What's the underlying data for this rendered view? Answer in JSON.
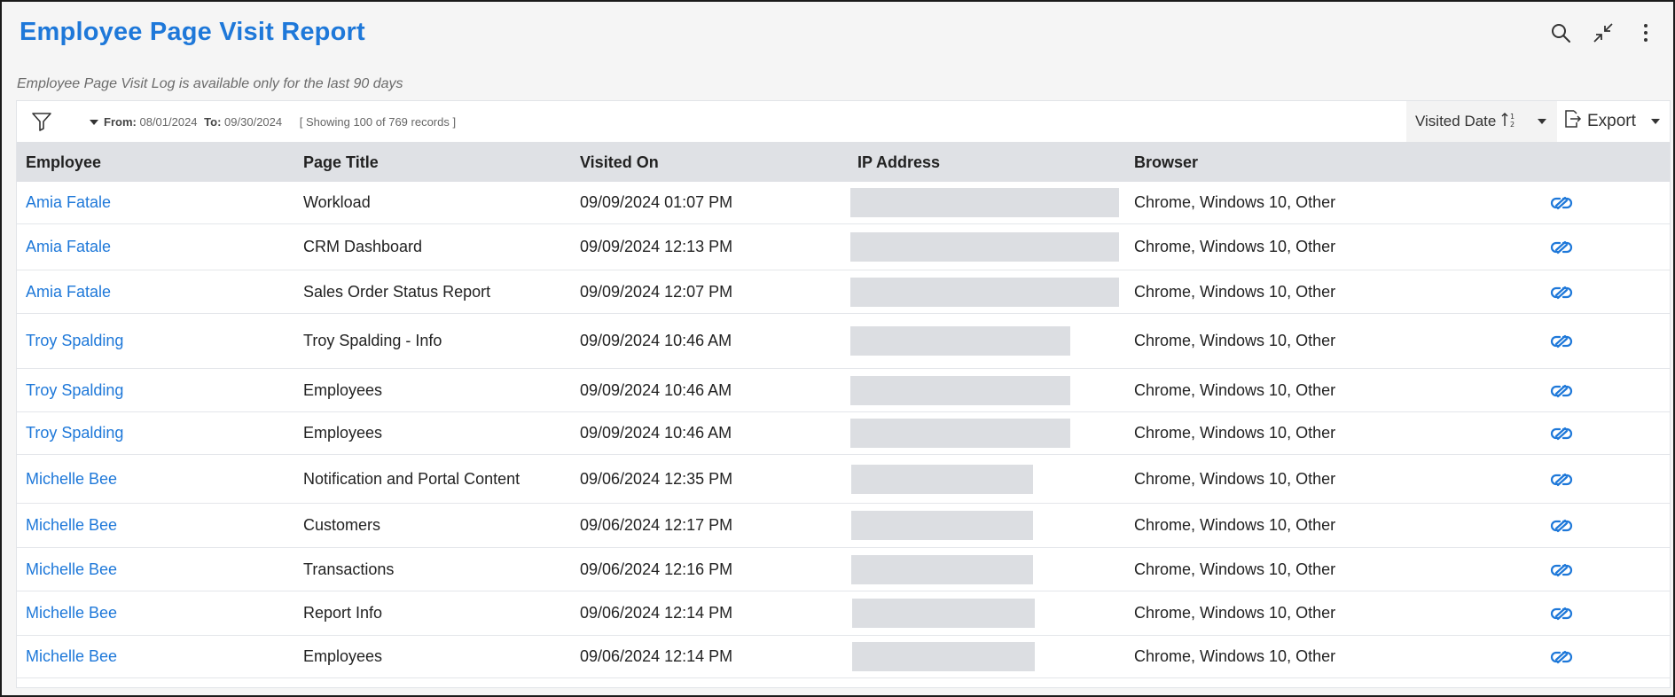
{
  "header": {
    "title": "Employee Page Visit Report",
    "subtitle": "Employee Page Visit Log is available only for the last 90 days"
  },
  "toolbar": {
    "from_label": "From:",
    "from_value": "08/01/2024",
    "to_label": "To:",
    "to_value": "09/30/2024",
    "records": "[ Showing 100 of 769 records ]",
    "sort_label": "Visited Date",
    "export_label": "Export"
  },
  "table": {
    "columns": [
      "Employee",
      "Page Title",
      "Visited On",
      "IP Address",
      "Browser"
    ],
    "rows": [
      {
        "employee": "Amia Fatale",
        "page_title": "Workload",
        "visited_on": "09/09/2024 01:07 PM",
        "browser": "Chrome, Windows 10, Other"
      },
      {
        "employee": "Amia Fatale",
        "page_title": "CRM Dashboard",
        "visited_on": "09/09/2024 12:13 PM",
        "browser": "Chrome, Windows 10, Other"
      },
      {
        "employee": "Amia Fatale",
        "page_title": "Sales Order Status Report",
        "visited_on": "09/09/2024 12:07 PM",
        "browser": "Chrome, Windows 10, Other"
      },
      {
        "employee": "Troy Spalding",
        "page_title": "Troy Spalding - Info",
        "visited_on": "09/09/2024 10:46 AM",
        "browser": "Chrome, Windows 10, Other"
      },
      {
        "employee": "Troy Spalding",
        "page_title": "Employees",
        "visited_on": "09/09/2024 10:46 AM",
        "browser": "Chrome, Windows 10, Other"
      },
      {
        "employee": "Troy Spalding",
        "page_title": "Employees",
        "visited_on": "09/09/2024 10:46 AM",
        "browser": "Chrome, Windows 10, Other"
      },
      {
        "employee": "Michelle Bee",
        "page_title": "Notification and Portal Content",
        "visited_on": "09/06/2024 12:35 PM",
        "browser": "Chrome, Windows 10, Other"
      },
      {
        "employee": "Michelle Bee",
        "page_title": "Customers",
        "visited_on": "09/06/2024 12:17 PM",
        "browser": "Chrome, Windows 10, Other"
      },
      {
        "employee": "Michelle Bee",
        "page_title": "Transactions",
        "visited_on": "09/06/2024 12:16 PM",
        "browser": "Chrome, Windows 10, Other"
      },
      {
        "employee": "Michelle Bee",
        "page_title": "Report Info",
        "visited_on": "09/06/2024 12:14 PM",
        "browser": "Chrome, Windows 10, Other"
      },
      {
        "employee": "Michelle Bee",
        "page_title": "Employees",
        "visited_on": "09/06/2024 12:14 PM",
        "browser": "Chrome, Windows 10, Other"
      }
    ]
  },
  "icons": {
    "search": "search-icon",
    "collapse": "collapse-icon",
    "more": "more-vertical-icon",
    "filter": "filter-icon",
    "sort": "sort-ascending-icon",
    "export": "export-icon",
    "link": "link-icon"
  },
  "colors": {
    "accent": "#1e78d9",
    "header_bg": "#dfe1e5",
    "redaction": "#dcdee2"
  }
}
